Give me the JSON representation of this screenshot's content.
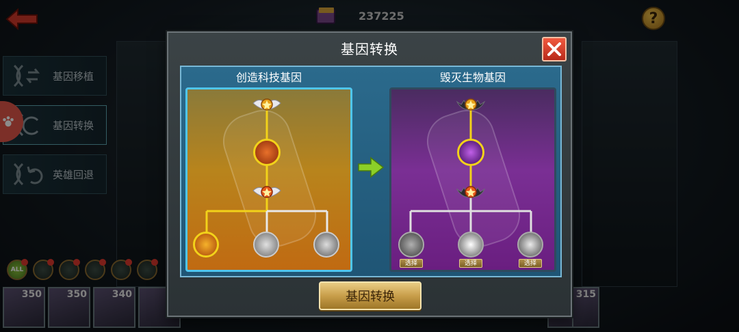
{
  "topbar": {
    "currency_value": "237225",
    "help_label": "?"
  },
  "side_menu": {
    "items": [
      {
        "label": "基因移植"
      },
      {
        "label": "基因转换"
      },
      {
        "label": "英雄回退"
      }
    ]
  },
  "filters": {
    "all_label": "ALL"
  },
  "hero_cards": [
    {
      "level": "350"
    },
    {
      "level": "350"
    },
    {
      "level": "340"
    },
    {
      "level": "315"
    }
  ],
  "modal": {
    "title": "基因转换",
    "left_panel": {
      "title": "创造科技基因"
    },
    "right_panel": {
      "title": "毁灭生物基因",
      "select_labels": [
        "选择",
        "选择",
        "选择"
      ]
    },
    "convert_button_label": "基因转换"
  },
  "colors": {
    "left_panel_tint": "#b8841c",
    "right_panel_tint": "#7a2f94",
    "tree_line_left": "#f2d21a",
    "tree_line_right": "#e0e0e0",
    "close_button": "#e04a32",
    "button_gold": "#c89e4a",
    "arrow_green": "#8ccf28"
  }
}
